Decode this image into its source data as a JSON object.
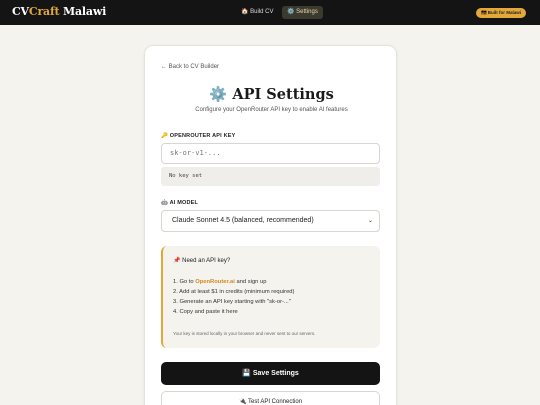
{
  "header": {
    "logo_cv": "CV",
    "logo_craft": "Craft",
    "logo_country": " Malawi",
    "nav": [
      {
        "icon": "🏠",
        "label": "Build CV"
      },
      {
        "icon": "⚙️",
        "label": "Settings"
      }
    ],
    "built_badge": "🇲🇼 Built for Malawi"
  },
  "page": {
    "back_link": "← Back to CV Builder",
    "title": "⚙️ API Settings",
    "subtitle": "Configure your OpenRouter API key to enable AI features"
  },
  "api_key": {
    "label": "🔑 OPENROUTER API KEY",
    "placeholder": "sk-or-v1-...",
    "status": "No key set"
  },
  "model": {
    "label": "🤖 AI MODEL",
    "selected": "Claude Sonnet 4.5 (balanced, recommended)"
  },
  "info": {
    "heading": "📌 Need an API key?",
    "step1_prefix": "1. Go to ",
    "step1_link": "OpenRouter.ai",
    "step1_suffix": " and sign up",
    "step2": "2. Add at least $1 in credits (minimum required)",
    "step3": "3. Generate an API key starting with \"sk-or-...\"",
    "step4": "4. Copy and paste it here",
    "note": "Your key is stored locally in your browser and never sent to our servers."
  },
  "actions": {
    "save": "💾 Save Settings",
    "test": "🔌 Test API Connection"
  }
}
